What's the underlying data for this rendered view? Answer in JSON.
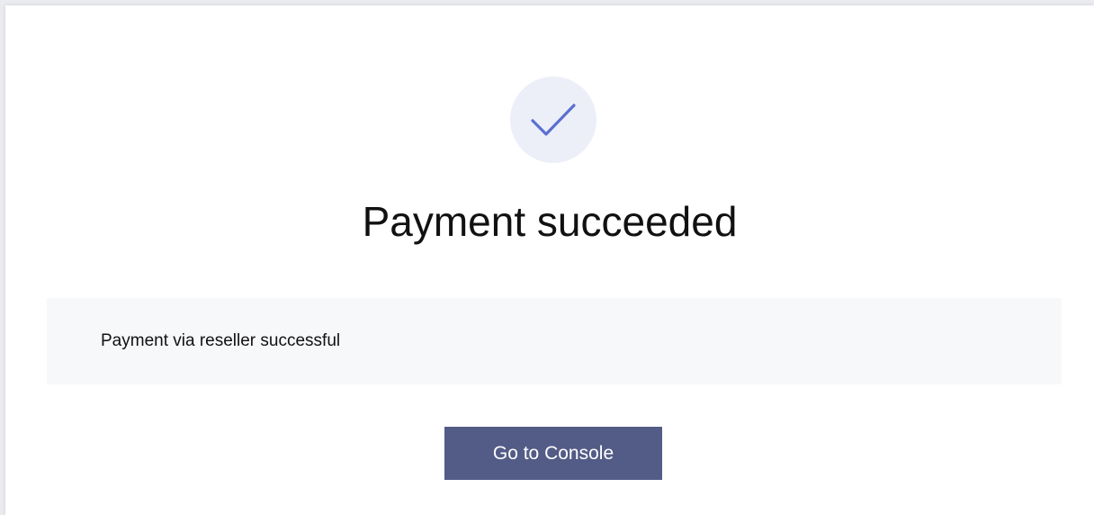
{
  "result": {
    "icon": "check-icon",
    "title": "Payment succeeded",
    "message": "Payment via reseller successful"
  },
  "actions": {
    "console_label": "Go to Console"
  },
  "colors": {
    "accent": "#525c86",
    "check": "#5b6fd1",
    "icon_bg": "#eceff8",
    "message_bg": "#f7f8fa"
  }
}
